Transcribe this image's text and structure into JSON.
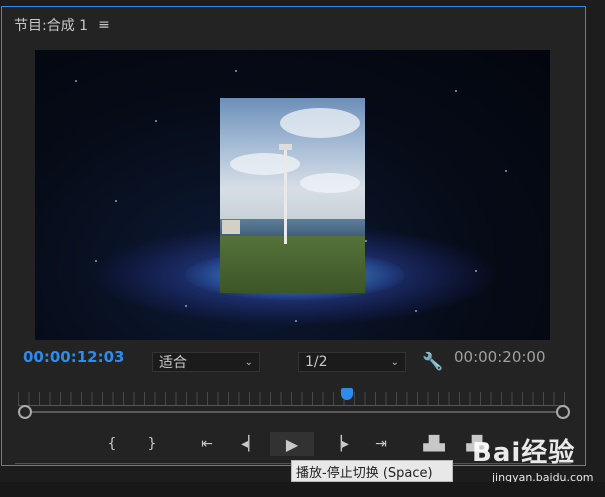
{
  "panel": {
    "title": "节目:合成 1",
    "menu_icon": "hamburger-menu-icon"
  },
  "viewer": {
    "current_timecode": "00:00:12:03",
    "duration_timecode": "00:00:20:00",
    "zoom_select": "适合",
    "resolution_select": "1/2",
    "settings_icon": "wrench-icon"
  },
  "timeline": {
    "playhead_position": 0.6
  },
  "transport": {
    "buttons": [
      {
        "name": "mark-in-icon",
        "glyph": "{"
      },
      {
        "name": "mark-out-icon",
        "glyph": "}"
      },
      {
        "name": "go-to-in-icon",
        "glyph": "⇤"
      },
      {
        "name": "step-back-icon",
        "glyph": "◀"
      },
      {
        "name": "play-icon",
        "glyph": "▶"
      },
      {
        "name": "step-forward-icon",
        "glyph": "▶"
      },
      {
        "name": "go-to-out-icon",
        "glyph": "⇥"
      },
      {
        "name": "lift-icon",
        "glyph": "⎍"
      },
      {
        "name": "extract-icon",
        "glyph": "⎍"
      }
    ]
  },
  "tooltip": {
    "text": "播放-停止切换 (Space)"
  },
  "watermark": {
    "brand": "Bai经验",
    "site": "jingyan.baidu.com"
  },
  "colors": {
    "accent": "#2d8ceb",
    "panel_bg": "#232323"
  }
}
